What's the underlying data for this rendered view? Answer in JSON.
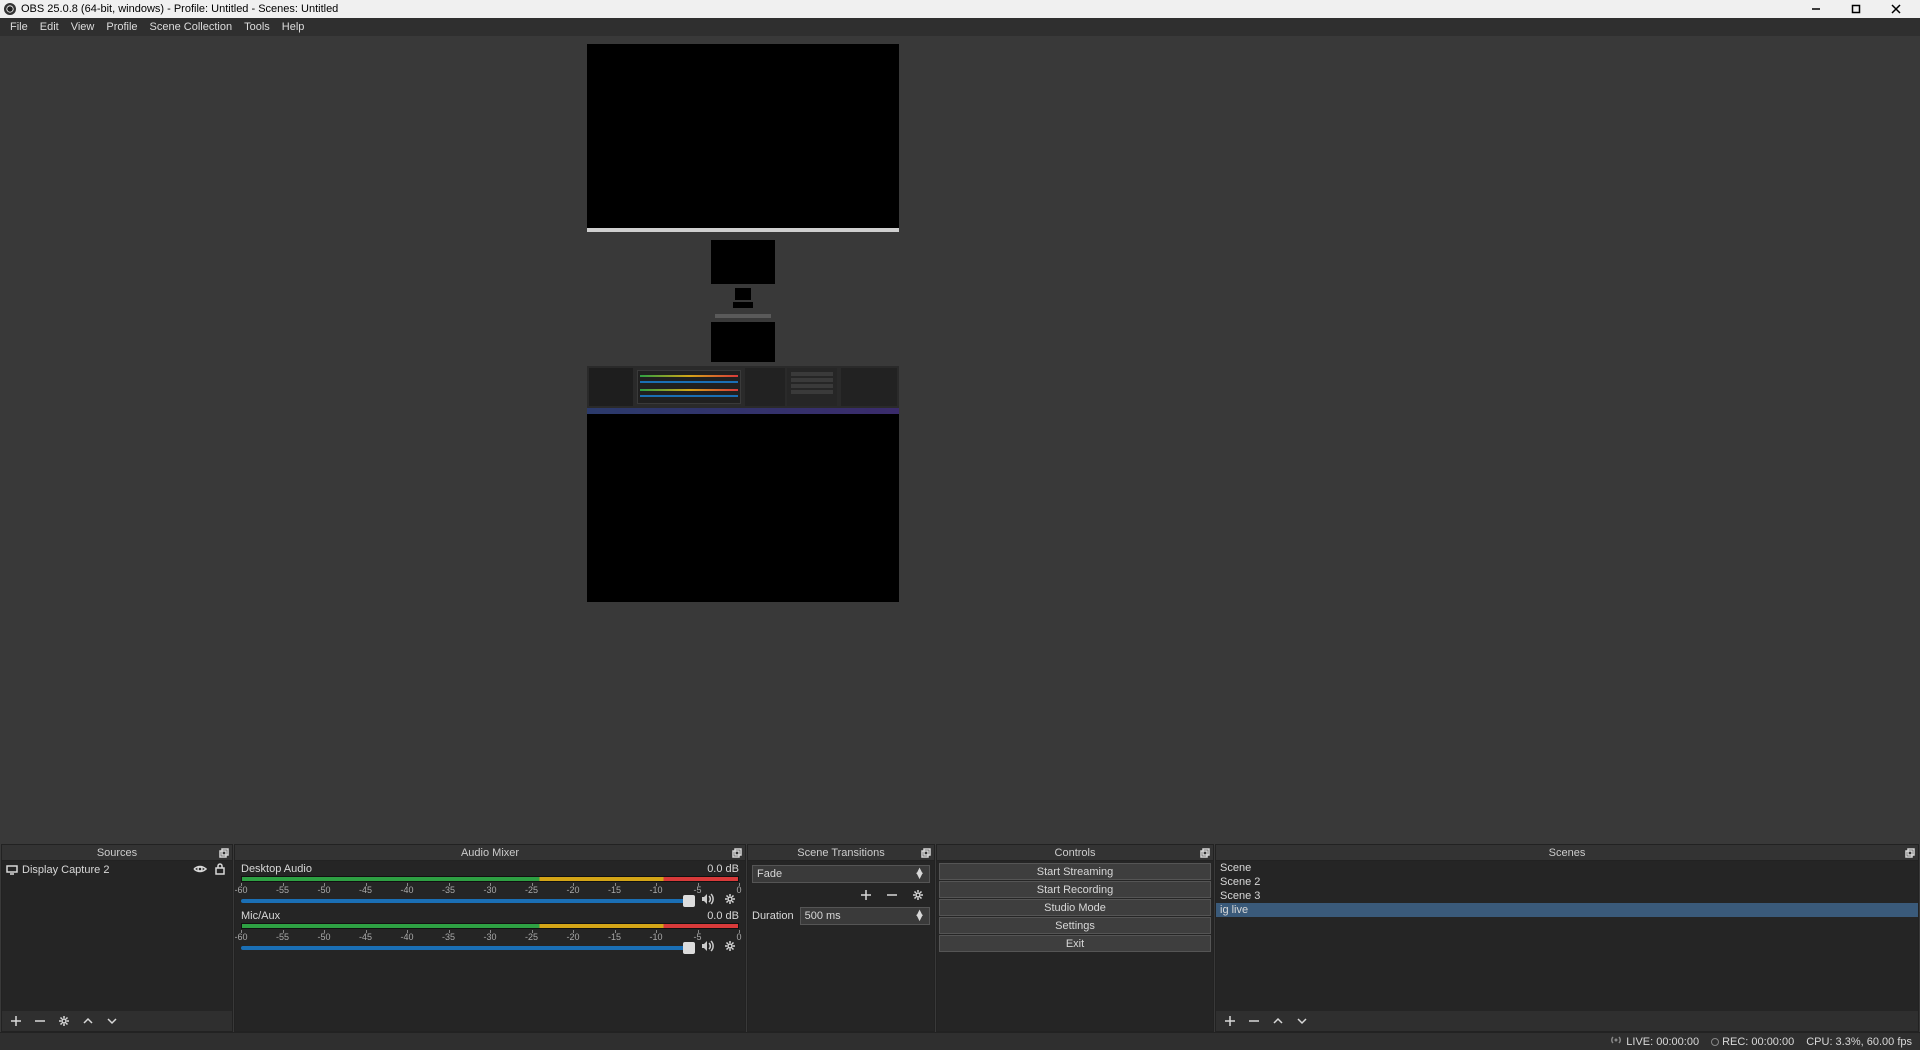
{
  "titlebar": {
    "title": "OBS 25.0.8 (64-bit, windows) - Profile: Untitled - Scenes: Untitled"
  },
  "menubar": [
    "File",
    "Edit",
    "View",
    "Profile",
    "Scene Collection",
    "Tools",
    "Help"
  ],
  "docks": {
    "sources": {
      "title": "Sources",
      "items": [
        {
          "label": "Display Capture 2"
        }
      ]
    },
    "mixer": {
      "title": "Audio Mixer",
      "channels": [
        {
          "name": "Desktop Audio",
          "level": "0.0 dB"
        },
        {
          "name": "Mic/Aux",
          "level": "0.0 dB"
        }
      ],
      "tick_labels": [
        "-60",
        "-55",
        "-50",
        "-45",
        "-40",
        "-35",
        "-30",
        "-25",
        "-20",
        "-15",
        "-10",
        "-5",
        "0"
      ]
    },
    "transitions": {
      "title": "Scene Transitions",
      "selected": "Fade",
      "duration_label": "Duration",
      "duration_value": "500 ms"
    },
    "controls": {
      "title": "Controls",
      "buttons": [
        "Start Streaming",
        "Start Recording",
        "Studio Mode",
        "Settings",
        "Exit"
      ]
    },
    "scenes": {
      "title": "Scenes",
      "items": [
        "Scene",
        "Scene 2",
        "Scene 3",
        "ig live"
      ],
      "selected_index": 3
    }
  },
  "statusbar": {
    "live": "LIVE: 00:00:00",
    "rec": "REC: 00:00:00",
    "cpu": "CPU: 3.3%, 60.00 fps"
  }
}
